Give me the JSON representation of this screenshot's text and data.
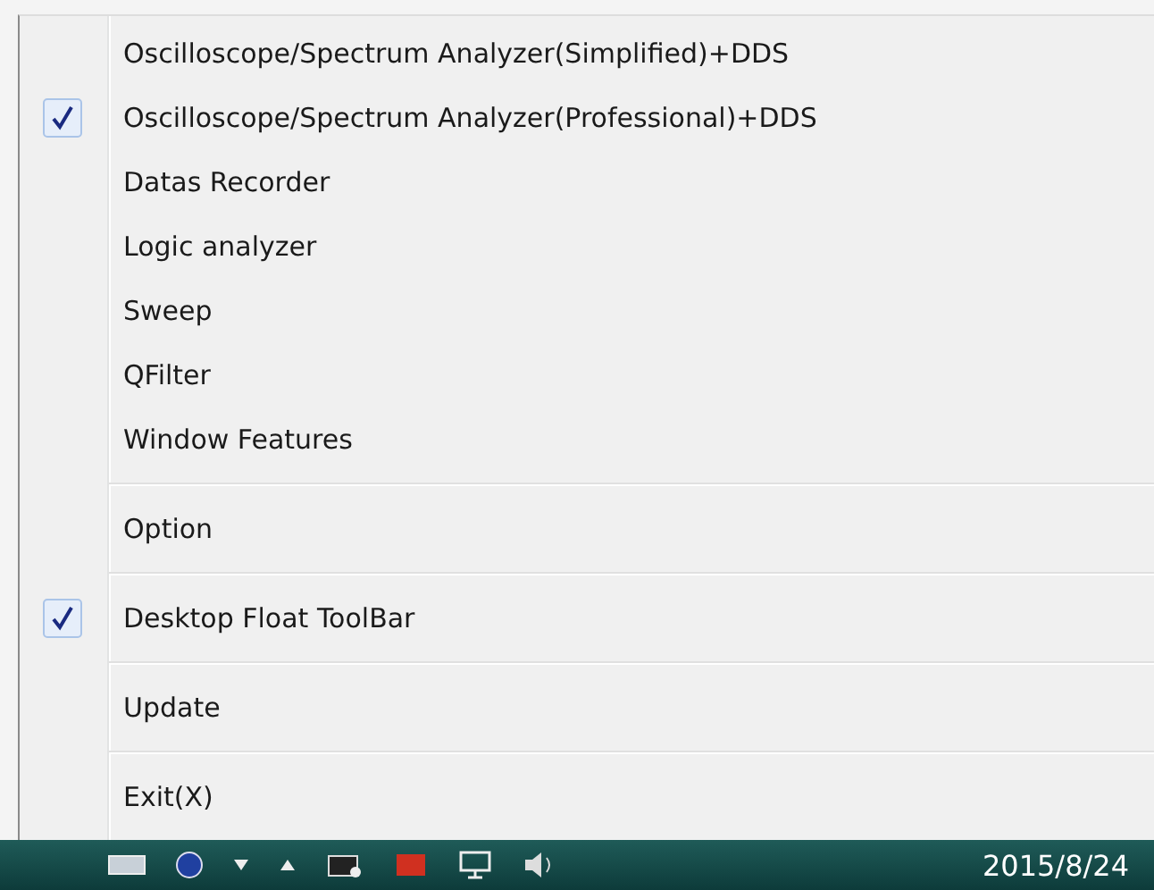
{
  "menu": {
    "items": [
      {
        "kind": "item",
        "label": "Oscilloscope/Spectrum Analyzer(Simplified)+DDS",
        "checked": false
      },
      {
        "kind": "item",
        "label": "Oscilloscope/Spectrum Analyzer(Professional)+DDS",
        "checked": true
      },
      {
        "kind": "item",
        "label": "Datas Recorder",
        "checked": false
      },
      {
        "kind": "item",
        "label": "Logic analyzer",
        "checked": false
      },
      {
        "kind": "item",
        "label": "Sweep",
        "checked": false
      },
      {
        "kind": "item",
        "label": "QFilter",
        "checked": false
      },
      {
        "kind": "item",
        "label": "Window Features",
        "checked": false
      },
      {
        "kind": "separator"
      },
      {
        "kind": "item",
        "label": "Option",
        "checked": false
      },
      {
        "kind": "separator"
      },
      {
        "kind": "item",
        "label": "Desktop Float ToolBar",
        "checked": true
      },
      {
        "kind": "separator"
      },
      {
        "kind": "item",
        "label": "Update",
        "checked": false
      },
      {
        "kind": "separator"
      },
      {
        "kind": "item",
        "label": "Exit(X)",
        "checked": false
      }
    ]
  },
  "taskbar": {
    "clock": "2015/8/24"
  }
}
